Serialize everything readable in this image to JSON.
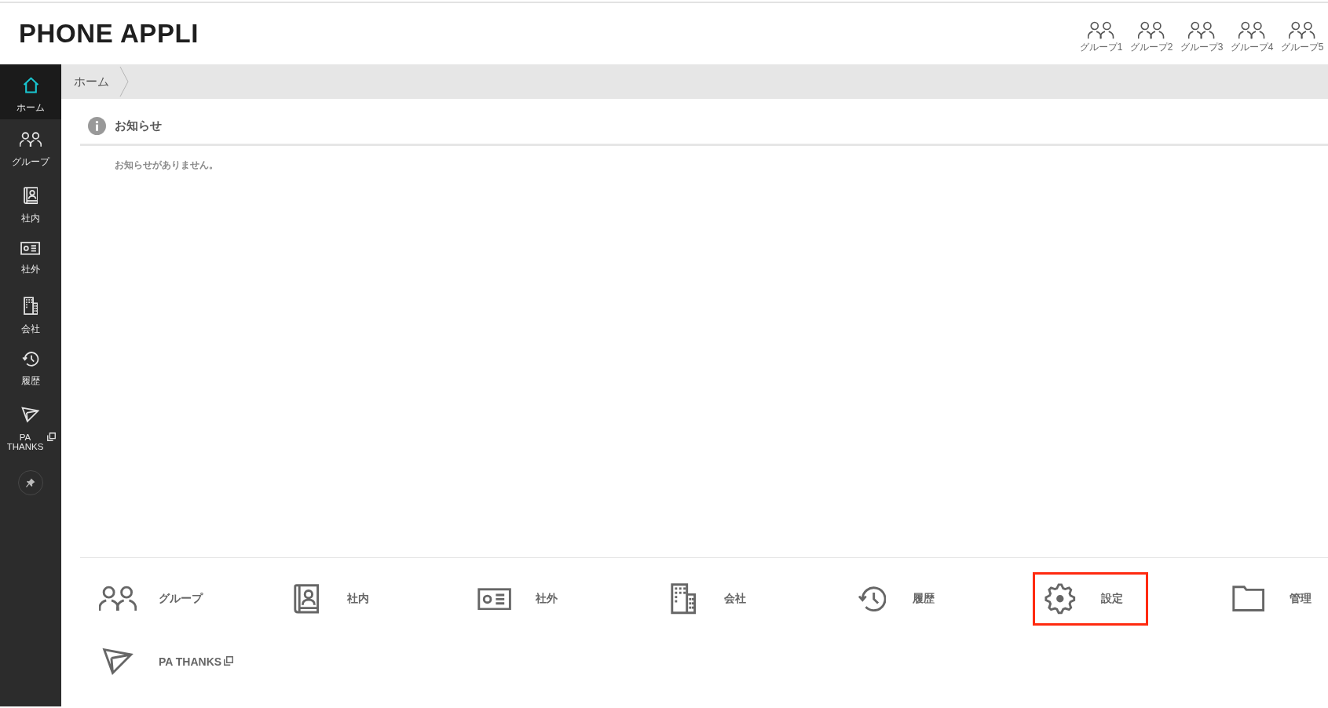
{
  "header": {
    "logo": "PHONE APPLI",
    "groups": [
      {
        "label": "グループ1"
      },
      {
        "label": "グループ2"
      },
      {
        "label": "グループ3"
      },
      {
        "label": "グループ4"
      },
      {
        "label": "グループ5"
      }
    ]
  },
  "sidebar": {
    "items": [
      {
        "label": "ホーム",
        "kind": "home",
        "selected": true,
        "new_window": false
      },
      {
        "label": "グループ",
        "kind": "group",
        "selected": false,
        "new_window": false
      },
      {
        "label": "社内",
        "kind": "directory",
        "selected": false,
        "new_window": false
      },
      {
        "label": "社外",
        "kind": "card",
        "selected": false,
        "new_window": false
      },
      {
        "label": "会社",
        "kind": "company",
        "selected": false,
        "new_window": false
      },
      {
        "label": "履歴",
        "kind": "history",
        "selected": false,
        "new_window": false
      },
      {
        "label": "PA THANKS",
        "kind": "thanks",
        "selected": false,
        "new_window": true
      }
    ]
  },
  "breadcrumb": {
    "items": [
      "ホーム"
    ]
  },
  "notice": {
    "title": "お知らせ",
    "message": "お知らせがありません。"
  },
  "shortcuts": [
    {
      "label": "グループ",
      "kind": "group",
      "highlighted": false,
      "new_window": false
    },
    {
      "label": "社内",
      "kind": "directory",
      "highlighted": false,
      "new_window": false
    },
    {
      "label": "社外",
      "kind": "card",
      "highlighted": false,
      "new_window": false
    },
    {
      "label": "会社",
      "kind": "company",
      "highlighted": false,
      "new_window": false
    },
    {
      "label": "履歴",
      "kind": "history",
      "highlighted": false,
      "new_window": false
    },
    {
      "label": "設定",
      "kind": "settings",
      "highlighted": true,
      "new_window": false
    },
    {
      "label": "管理",
      "kind": "folder",
      "highlighted": false,
      "new_window": false
    },
    {
      "label": "PA THANKS",
      "kind": "thanks",
      "highlighted": false,
      "new_window": true
    }
  ]
}
